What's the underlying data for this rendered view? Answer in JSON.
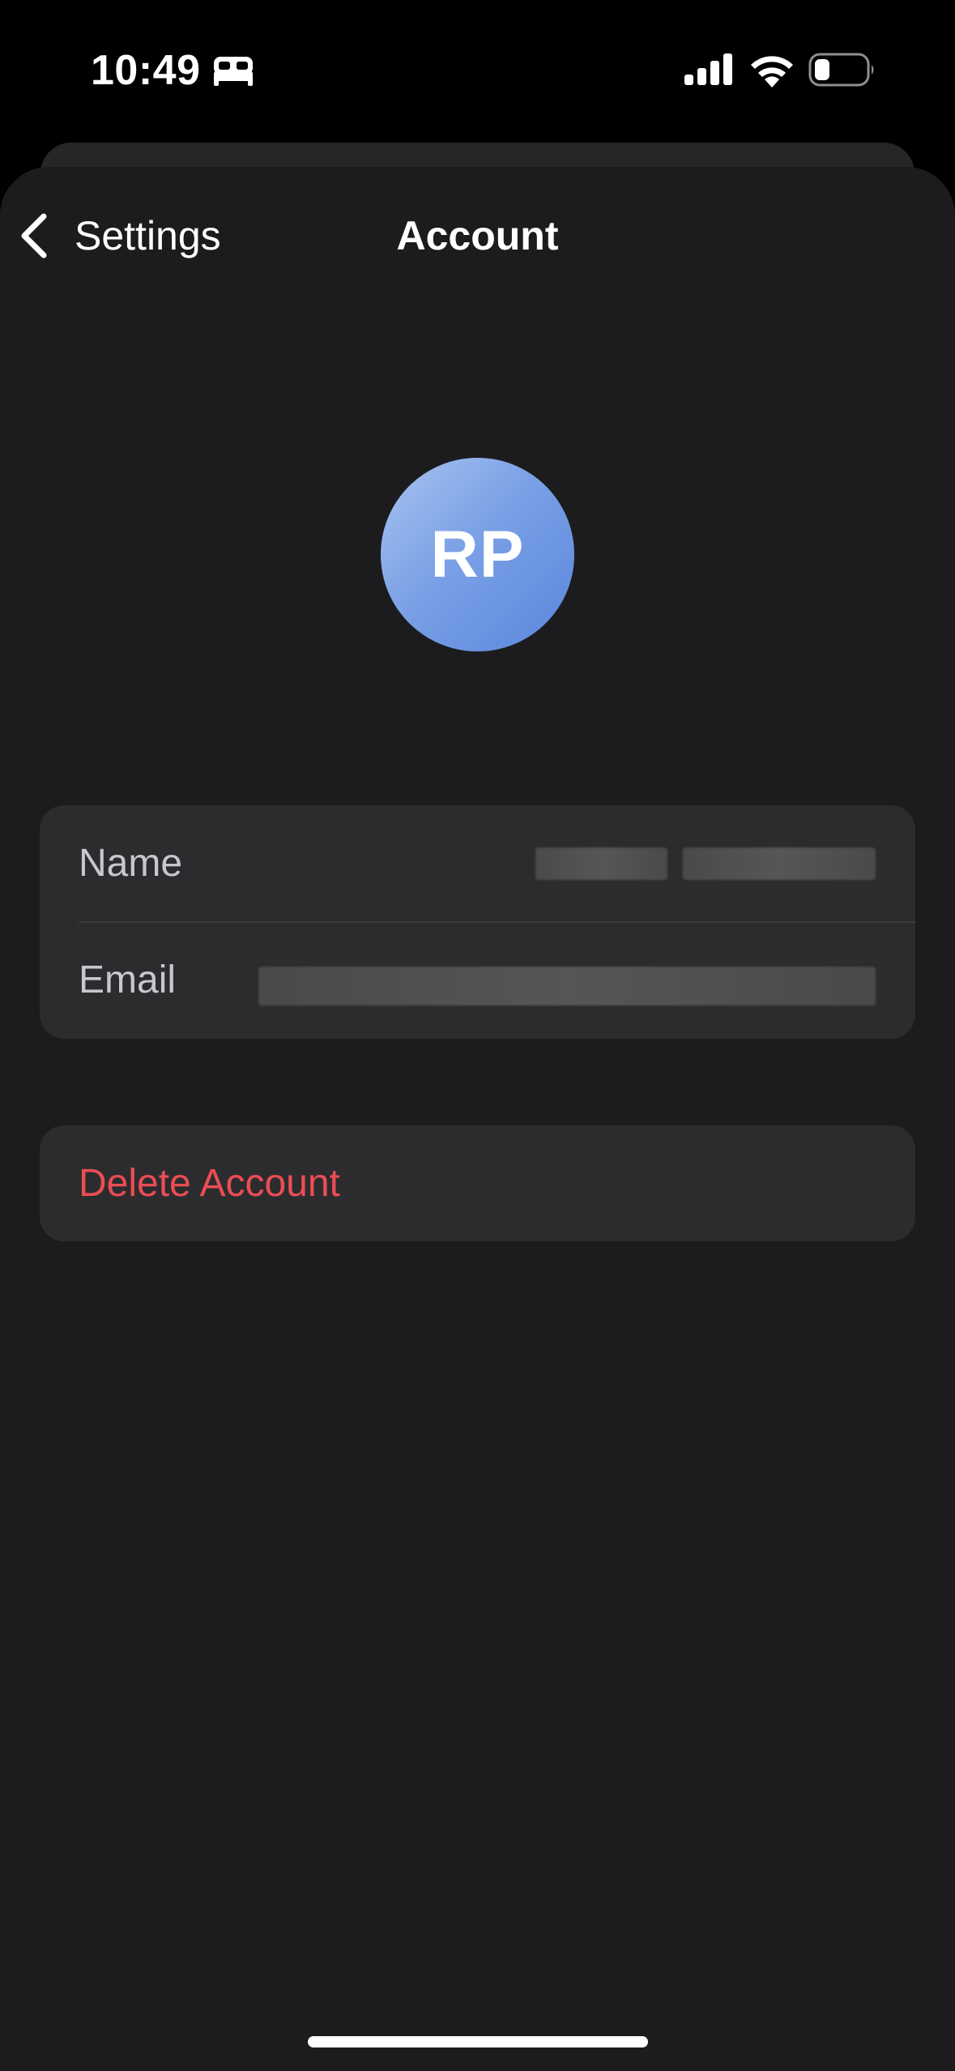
{
  "status_bar": {
    "time": "10:49",
    "focus_icon": "bed-icon",
    "signal_icon": "cellular-signal-icon",
    "wifi_icon": "wifi-icon",
    "battery_icon": "battery-icon",
    "battery_level": 0.2
  },
  "nav": {
    "back_label": "Settings",
    "back_icon": "chevron-left-icon",
    "title": "Account"
  },
  "avatar": {
    "initials": "RP"
  },
  "info": {
    "name_label": "Name",
    "email_label": "Email"
  },
  "actions": {
    "delete_label": "Delete Account"
  },
  "colors": {
    "background": "#1c1c1e",
    "group_background": "#2c2c2e",
    "destructive": "#eb4d55",
    "avatar_gradient_start": "#a9c3f0",
    "avatar_gradient_end": "#5a86dc"
  }
}
